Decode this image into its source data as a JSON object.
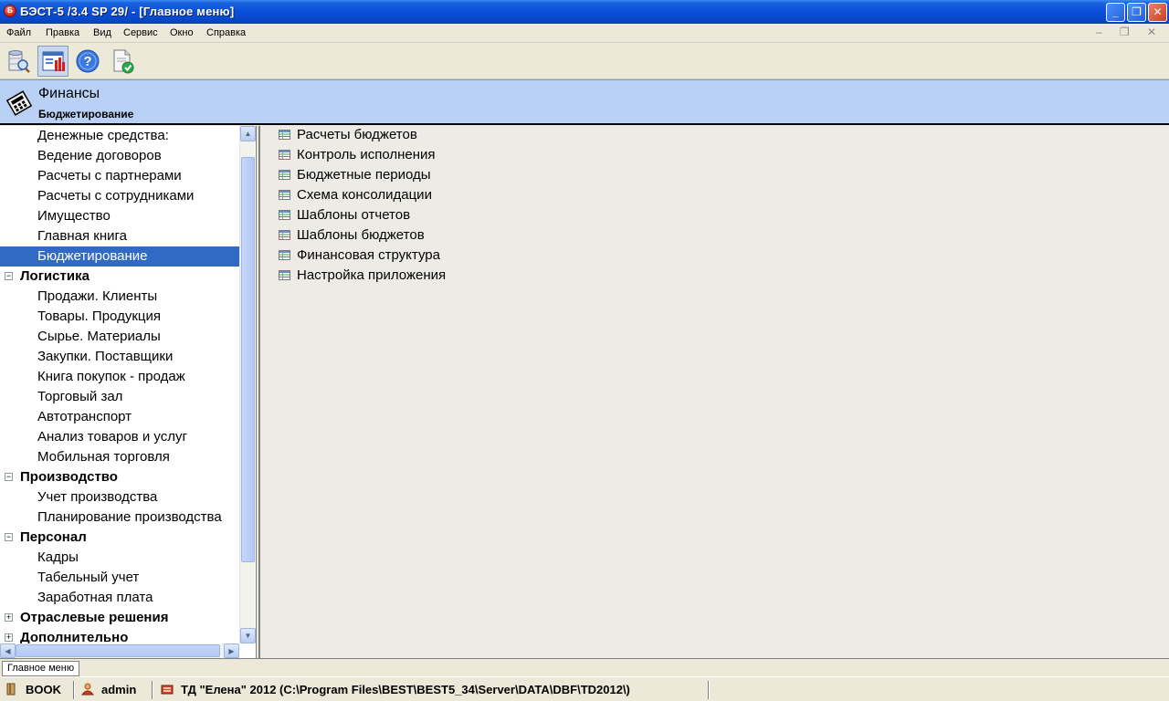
{
  "window": {
    "title": "БЭСТ-5 /3.4 SP 29/ - [Главное меню]",
    "app_icon_glyph": "Б",
    "minimize_glyph": "_",
    "maximize_glyph": "❐",
    "close_glyph": "✕"
  },
  "menu": {
    "items": [
      "Файл",
      "Правка",
      "Вид",
      "Сервис",
      "Окно",
      "Справка"
    ],
    "mdi_controls": "– ❐ ✕"
  },
  "toolbar": {
    "icons": [
      "database-search-icon",
      "main-menu-icon",
      "help-icon",
      "document-check-icon"
    ]
  },
  "header": {
    "title": "Финансы",
    "subtitle": "Бюджетирование"
  },
  "tree": {
    "rows": [
      {
        "label": "Денежные средства:",
        "kind": "child"
      },
      {
        "label": "Ведение договоров",
        "kind": "child"
      },
      {
        "label": "Расчеты с партнерами",
        "kind": "child"
      },
      {
        "label": "Расчеты с сотрудниками",
        "kind": "child"
      },
      {
        "label": "Имущество",
        "kind": "child"
      },
      {
        "label": "Главная книга",
        "kind": "child"
      },
      {
        "label": "Бюджетирование",
        "kind": "child",
        "selected": true
      },
      {
        "label": "Логистика",
        "kind": "group",
        "expander": "−"
      },
      {
        "label": "Продажи. Клиенты",
        "kind": "child"
      },
      {
        "label": "Товары. Продукция",
        "kind": "child"
      },
      {
        "label": "Сырье. Материалы",
        "kind": "child"
      },
      {
        "label": "Закупки. Поставщики",
        "kind": "child"
      },
      {
        "label": "Книга покупок - продаж",
        "kind": "child"
      },
      {
        "label": "Торговый зал",
        "kind": "child"
      },
      {
        "label": "Автотранспорт",
        "kind": "child"
      },
      {
        "label": "Анализ товаров и услуг",
        "kind": "child"
      },
      {
        "label": "Мобильная торговля",
        "kind": "child"
      },
      {
        "label": "Производство",
        "kind": "group",
        "expander": "−"
      },
      {
        "label": "Учет производства",
        "kind": "child"
      },
      {
        "label": "Планирование производства",
        "kind": "child"
      },
      {
        "label": "Персонал",
        "kind": "group",
        "expander": "−"
      },
      {
        "label": "Кадры",
        "kind": "child"
      },
      {
        "label": "Табельный учет",
        "kind": "child"
      },
      {
        "label": "Заработная плата",
        "kind": "child"
      },
      {
        "label": "Отраслевые решения",
        "kind": "group",
        "expander": "+"
      },
      {
        "label": "Дополнительно",
        "kind": "group",
        "expander": "+"
      }
    ]
  },
  "content": {
    "items": [
      "Расчеты бюджетов",
      "Контроль исполнения",
      "Бюджетные периоды",
      "Схема консолидации",
      "Шаблоны отчетов",
      "Шаблоны бюджетов",
      "Финансовая структура",
      "Настройка приложения"
    ]
  },
  "tabs": {
    "active": "Главное меню"
  },
  "status": {
    "book": "BOOK",
    "user": "admin",
    "database": "ТД \"Елена\" 2012 (C:\\Program Files\\BEST\\BEST5_34\\Server\\DATA\\DBF\\TD2012\\)"
  }
}
